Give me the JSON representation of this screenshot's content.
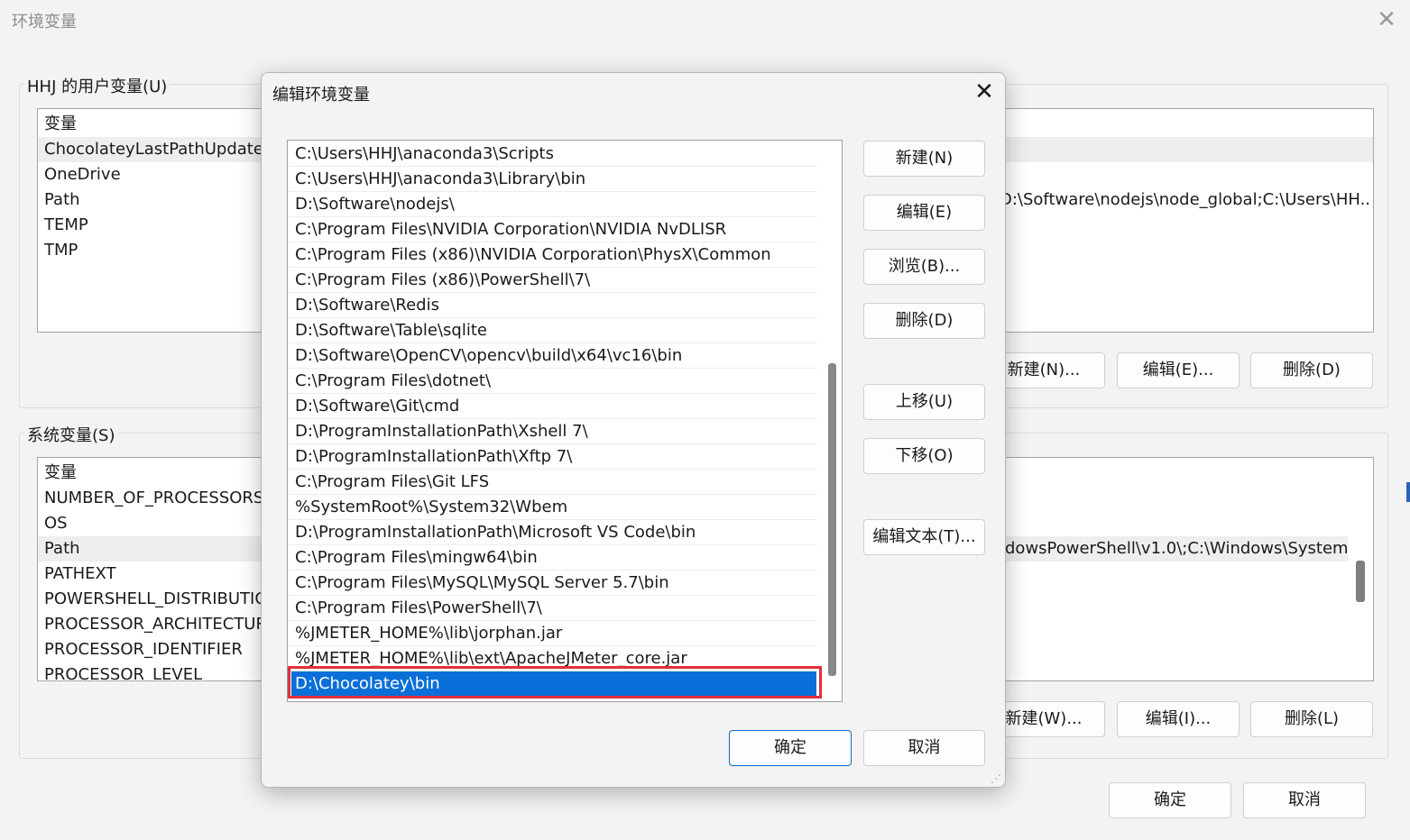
{
  "outer": {
    "title": "环境变量",
    "user_group_label": "HHJ 的用户变量(U)",
    "user_vars_header": "变量",
    "user_vars": [
      "ChocolateyLastPathUpdate",
      "OneDrive",
      "Path",
      "TEMP",
      "TMP"
    ],
    "user_path_value": "D:\\Software\\nodejs\\node_global;C:\\Users\\HH...",
    "user_buttons": {
      "new": "新建(N)...",
      "edit": "编辑(E)...",
      "delete": "删除(D)"
    },
    "sys_group_label": "系统变量(S)",
    "sys_vars_header": "变量",
    "sys_vars": [
      "NUMBER_OF_PROCESSORS",
      "OS",
      "Path",
      "PATHEXT",
      "POWERSHELL_DISTRIBUTIO...",
      "PROCESSOR_ARCHITECTUR...",
      "PROCESSOR_IDENTIFIER",
      "PROCESSOR_LEVEL"
    ],
    "sys_path_value": "dowsPowerShell\\v1.0\\;C:\\Windows\\System...",
    "sys_buttons": {
      "new": "新建(W)...",
      "edit": "编辑(I)...",
      "delete": "删除(L)"
    },
    "ok": "确定",
    "cancel": "取消",
    "close_icon": "✕"
  },
  "dialog": {
    "title": "编辑环境变量",
    "close_icon": "✕",
    "paths": [
      "C:\\Users\\HHJ\\anaconda3\\Scripts",
      "C:\\Users\\HHJ\\anaconda3\\Library\\bin",
      "D:\\Software\\nodejs\\",
      "C:\\Program Files\\NVIDIA Corporation\\NVIDIA NvDLISR",
      "C:\\Program Files (x86)\\NVIDIA Corporation\\PhysX\\Common",
      "C:\\Program Files (x86)\\PowerShell\\7\\",
      "D:\\Software\\Redis",
      "D:\\Software\\Table\\sqlite",
      "D:\\Software\\OpenCV\\opencv\\build\\x64\\vc16\\bin",
      "C:\\Program Files\\dotnet\\",
      "D:\\Software\\Git\\cmd",
      "D:\\ProgramInstallationPath\\Xshell 7\\",
      "D:\\ProgramInstallationPath\\Xftp 7\\",
      "C:\\Program Files\\Git LFS",
      "%SystemRoot%\\System32\\Wbem",
      "D:\\ProgramInstallationPath\\Microsoft VS Code\\bin",
      "C:\\Program Files\\mingw64\\bin",
      "C:\\Program Files\\MySQL\\MySQL Server 5.7\\bin",
      "C:\\Program Files\\PowerShell\\7\\",
      "%JMETER_HOME%\\lib\\jorphan.jar",
      "%JMETER_HOME%\\lib\\ext\\ApacheJMeter_core.jar",
      "D:\\Chocolatey\\bin"
    ],
    "selected_path": "D:\\Chocolatey\\bin",
    "buttons": {
      "new": "新建(N)",
      "edit": "编辑(E)",
      "browse": "浏览(B)...",
      "delete": "删除(D)",
      "move_up": "上移(U)",
      "move_down": "下移(O)",
      "edit_text": "编辑文本(T)..."
    },
    "ok": "确定",
    "cancel": "取消",
    "resize_grip_icon": "⋰"
  },
  "colors": {
    "selection": "#0a6fd8",
    "highlight_frame": "#e52e3a",
    "primary_border": "#0f6ac7"
  }
}
